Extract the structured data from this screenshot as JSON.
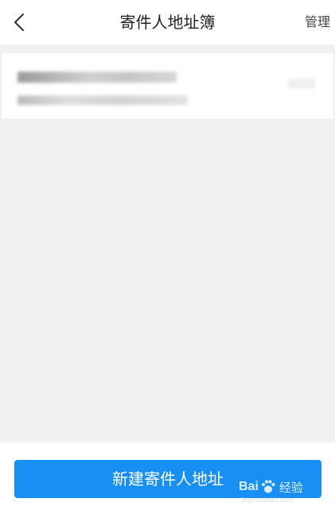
{
  "header": {
    "title": "寄件人地址簿",
    "manage_label": "管理",
    "back_icon": "chevron-left-icon"
  },
  "address_list": [
    {
      "name_and_phone": "",
      "address": "",
      "note": "content blurred in screenshot"
    }
  ],
  "footer": {
    "new_button_label": "新建寄件人地址",
    "button_color": "#1890f3"
  },
  "watermark": {
    "brand_prefix": "Bai",
    "brand_suffix": "经验",
    "url": "jingyan.baidu.com"
  },
  "colors": {
    "background": "#f1f1f1",
    "header_bg": "#ffffff",
    "title_text": "#222222",
    "accent": "#1890f3"
  }
}
